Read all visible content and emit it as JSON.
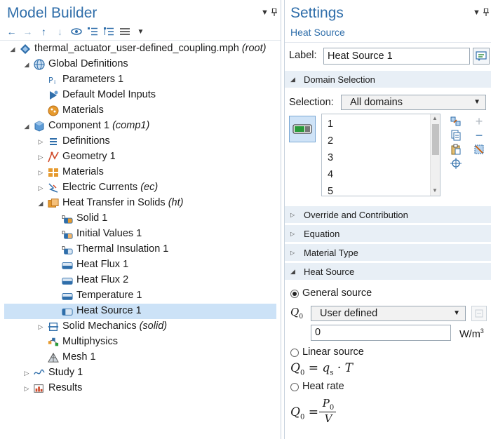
{
  "model_builder": {
    "title": "Model Builder",
    "pin_symbols": "▾ ⊥",
    "toolbar": [
      "back-arrow-icon",
      "forward-arrow-icon",
      "move-up-icon",
      "move-down-icon",
      "show-icon",
      "collapse-all-icon",
      "expand-all-icon",
      "list-icon",
      "dropdown-icon"
    ],
    "tree": [
      {
        "label": "thermal_actuator_user-defined_coupling.mph",
        "tag": "(root)",
        "depth": 0,
        "expander": "down",
        "icon": "model-file-icon"
      },
      {
        "label": "Global Definitions",
        "tag": "",
        "depth": 1,
        "expander": "down",
        "icon": "globe-icon"
      },
      {
        "label": "Parameters 1",
        "tag": "",
        "depth": 2,
        "expander": "",
        "icon": "parameters-icon"
      },
      {
        "label": "Default Model Inputs",
        "tag": "",
        "depth": 2,
        "expander": "",
        "icon": "model-inputs-icon"
      },
      {
        "label": "Materials",
        "tag": "",
        "depth": 2,
        "expander": "",
        "icon": "materials-globe-icon"
      },
      {
        "label": "Component 1",
        "tag": "(comp1)",
        "depth": 1,
        "expander": "down",
        "icon": "component-icon"
      },
      {
        "label": "Definitions",
        "tag": "",
        "depth": 2,
        "expander": "right",
        "icon": "definitions-icon"
      },
      {
        "label": "Geometry 1",
        "tag": "",
        "depth": 2,
        "expander": "right",
        "icon": "geometry-icon"
      },
      {
        "label": "Materials",
        "tag": "",
        "depth": 2,
        "expander": "right",
        "icon": "materials-icon"
      },
      {
        "label": "Electric Currents",
        "tag": "(ec)",
        "depth": 2,
        "expander": "right",
        "icon": "electric-currents-icon"
      },
      {
        "label": "Heat Transfer in Solids",
        "tag": "(ht)",
        "depth": 2,
        "expander": "down",
        "icon": "heat-transfer-icon"
      },
      {
        "label": "Solid 1",
        "tag": "",
        "depth": 3,
        "expander": "",
        "icon": "solid-node-icon"
      },
      {
        "label": "Initial Values 1",
        "tag": "",
        "depth": 3,
        "expander": "",
        "icon": "initial-values-icon"
      },
      {
        "label": "Thermal Insulation 1",
        "tag": "",
        "depth": 3,
        "expander": "",
        "icon": "thermal-insulation-icon"
      },
      {
        "label": "Heat Flux 1",
        "tag": "",
        "depth": 3,
        "expander": "",
        "icon": "heat-flux-icon"
      },
      {
        "label": "Heat Flux 2",
        "tag": "",
        "depth": 3,
        "expander": "",
        "icon": "heat-flux-icon"
      },
      {
        "label": "Temperature 1",
        "tag": "",
        "depth": 3,
        "expander": "",
        "icon": "temperature-icon"
      },
      {
        "label": "Heat Source 1",
        "tag": "",
        "depth": 3,
        "expander": "",
        "icon": "heat-source-icon",
        "selected": true
      },
      {
        "label": "Solid Mechanics",
        "tag": "(solid)",
        "depth": 2,
        "expander": "right",
        "icon": "solid-mechanics-icon"
      },
      {
        "label": "Multiphysics",
        "tag": "",
        "depth": 2,
        "expander": "",
        "icon": "multiphysics-icon"
      },
      {
        "label": "Mesh 1",
        "tag": "",
        "depth": 2,
        "expander": "",
        "icon": "mesh-icon"
      },
      {
        "label": "Study 1",
        "tag": "",
        "depth": 1,
        "expander": "right",
        "icon": "study-icon"
      },
      {
        "label": "Results",
        "tag": "",
        "depth": 1,
        "expander": "right",
        "icon": "results-icon"
      }
    ]
  },
  "settings": {
    "title": "Settings",
    "subtitle": "Heat Source",
    "label_text": "Label:",
    "label_value": "Heat Source 1",
    "sections": {
      "domain_selection": "Domain Selection",
      "override": "Override and Contribution",
      "equation": "Equation",
      "material_type": "Material Type",
      "heat_source": "Heat Source"
    },
    "selection_label": "Selection:",
    "selection_value": "All domains",
    "domains": [
      "1",
      "2",
      "3",
      "4",
      "5"
    ],
    "general_source": "General source",
    "q0_symbol": "Q",
    "q0_sub": "0",
    "q0_option": "User defined",
    "q0_value": "0",
    "unit_base": "W/m",
    "unit_exp": "3",
    "linear_source": "Linear source",
    "linear_eq_rhs": "q",
    "linear_eq_sub": "s",
    "linear_eq_var": "T",
    "heat_rate": "Heat rate",
    "heat_rate_num": "P",
    "heat_rate_num_sub": "0",
    "heat_rate_den": "V",
    "colors": {
      "accent": "#2f6eaa",
      "selection": "#cce2f7",
      "section_bg": "#e8eff6"
    }
  }
}
